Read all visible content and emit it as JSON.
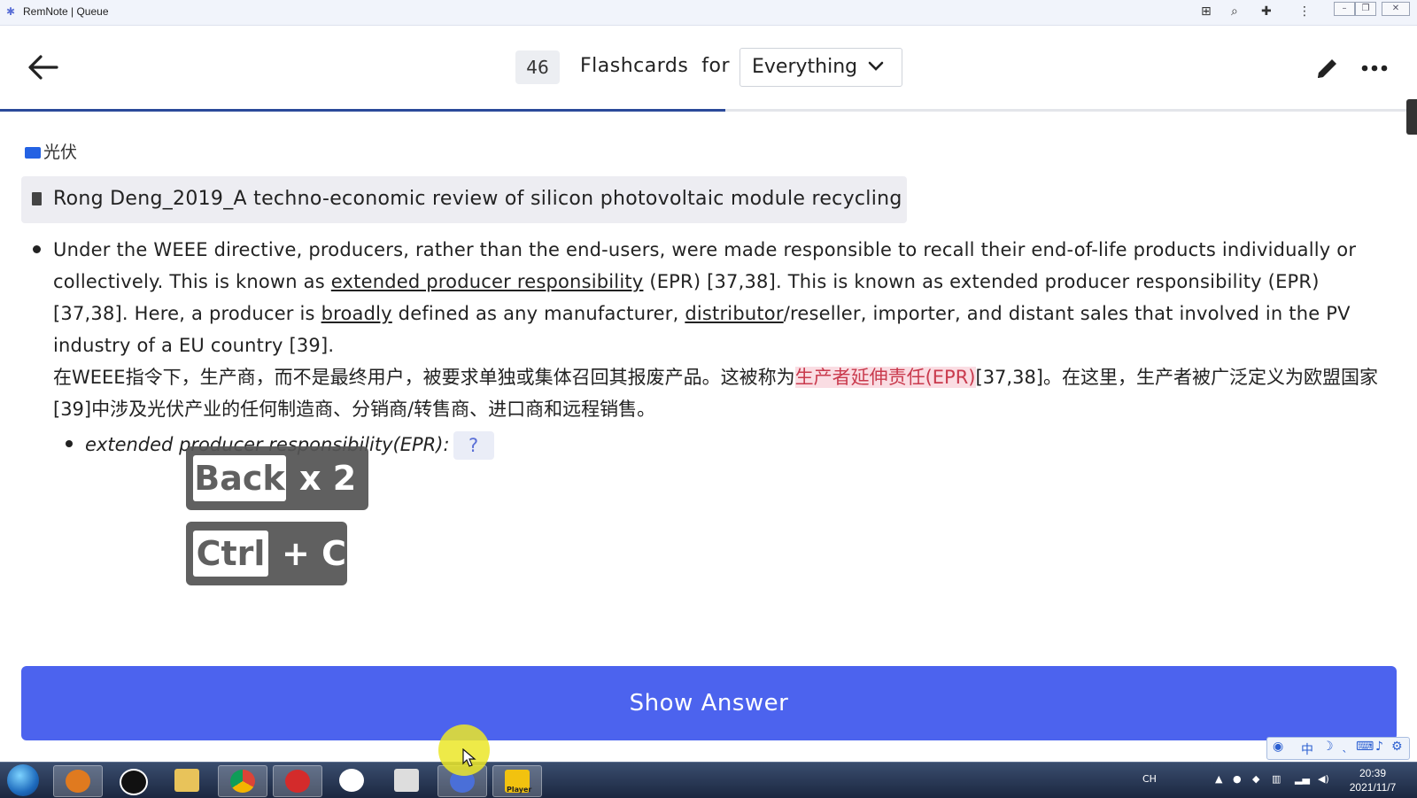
{
  "window": {
    "title": "RemNote | Queue"
  },
  "header": {
    "card_count": "46",
    "flashcards_label": "Flashcards  for",
    "scope_value": "Everything"
  },
  "progress": {
    "fraction": 0.516
  },
  "folder": {
    "label": "光伏"
  },
  "document": {
    "title": "Rong Deng_2019_A techno-economic review of silicon photovoltaic module recycling"
  },
  "paragraph_en": {
    "p1": "Under the WEEE directive, producers, rather than the end-users, were made responsible to recall their end-of-life products individually or collectively. This is known as ",
    "link1": "extended producer responsibility",
    "p2": " (EPR) [37,38]. This is known as extended producer responsibility (EPR) [37,38]. Here, a producer is ",
    "link2": "broadly",
    "p3": " defined as any manufacturer, ",
    "link3": "distributor",
    "p4": "/reseller, importer, and distant sales that involved in the PV industry of a EU country [39]."
  },
  "paragraph_zh": {
    "z1": " 在WEEE指令下，生产商，而不是最终用户，被要求单独或集体召回其报废产品。这被称为",
    "highlight": "生产者延伸责任(EPR)",
    "z2": "[37,38]。在这里，生产者被广泛定义为欧盟国家[39]中涉及光伏产业的任何制造商、分销商/转售商、进口商和远程销售。"
  },
  "question": {
    "prompt": "extended producer responsibility(EPR):",
    "placeholder": "?"
  },
  "key_overlays": [
    {
      "key": "Back",
      "suffix": "x 2"
    },
    {
      "key": "Ctrl",
      "suffix": "+ C"
    }
  ],
  "show_answer_label": "Show Answer",
  "ime": {
    "mode": "中"
  },
  "taskbar": {
    "tray_lang": "CH",
    "time": "20:39",
    "date": "2021/11/7",
    "player_label": "Player"
  },
  "colors": {
    "accent": "#4c63ee",
    "progress": "#2b4a9a",
    "highlight_bg": "#fadde3",
    "highlight_text": "#c93a4d",
    "folder": "#2462e3"
  }
}
